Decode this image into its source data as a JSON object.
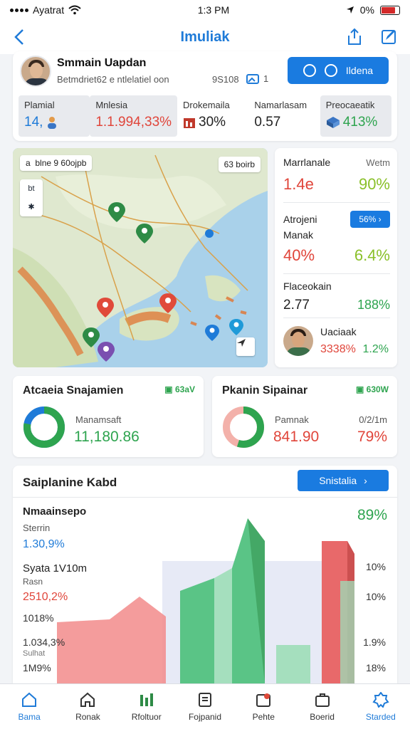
{
  "status": {
    "carrier": "Ayatrat",
    "time": "1:3 PM",
    "battery_text": "0%"
  },
  "nav": {
    "title": "Imuliak"
  },
  "profile": {
    "name": "Smmain Uapdan",
    "subtitle": "Betmdriet62 e ntlelatiel oon",
    "code": "9S108",
    "count": "1",
    "button_label": "Ildena",
    "stats": [
      {
        "label": "Plamial",
        "value": "14,",
        "color": "#1f7bd8"
      },
      {
        "label": "Mnlesia",
        "value": "1.1.994,33%",
        "color": "#e0453a"
      },
      {
        "label": "Drokemaila",
        "value": "30%",
        "color": "#222222"
      },
      {
        "label": "Namarlasam",
        "value": "0.57",
        "color": "#222222"
      },
      {
        "label": "Preocaeatik",
        "value": "413%",
        "color": "#2ea44f"
      }
    ]
  },
  "map": {
    "chip_left_a": "a",
    "chip_left_b": "blne 9 60ojpb",
    "chip_right": "63 boirb",
    "ctrl_top": "bt",
    "ctrl_bottom": "✱"
  },
  "side": {
    "s1_title": "Marrlanale",
    "s1_sub": "Wetm",
    "s1_v1": "1.4e",
    "s1_v2": "90%",
    "s2_title_a": "Atrojeni",
    "s2_chip": "56%",
    "s2_title_b": "Manak",
    "s2_v1": "40%",
    "s2_v2": "6.4%",
    "s3_title": "Flaceokain",
    "s3_v1": "2.77",
    "s3_v2": "188%",
    "s4_title": "Uaciaak",
    "s4_v1": "3338%",
    "s4_v2": "1.2%"
  },
  "kpi_left": {
    "title": "Atcaeia Snajamien",
    "badge": "63aV",
    "label": "Manamsaft",
    "value": "11,180.86",
    "donut_fraction": 0.78
  },
  "kpi_right": {
    "title": "Pkanin Sipainar",
    "badge": "630W",
    "label": "Pamnak",
    "label2": "0/2/1m",
    "value": "841.90",
    "pct": "79%",
    "donut_fraction": 0.55
  },
  "bottom": {
    "title": "Saiplanine Kabd",
    "button_label": "Snistalia",
    "r1_title": "Nmaainsepo",
    "r1_pct": "89%",
    "r1_sub": "Sterrin",
    "r1_val": "1.30,9%",
    "r2_title": "Syata 1V10m",
    "r2_right": "10%",
    "r2_sub": "Rasn",
    "r2_val": "2510,2%",
    "r2_right2": "10%",
    "r3_val": "1018%",
    "r4_val": "1.034,3%",
    "r4_right": "1.9%",
    "r4_sub": "Sulhat",
    "r5_val": "1M9%",
    "r5_right": "18%"
  },
  "tabs": [
    {
      "label": "Bama",
      "icon": "home-icon",
      "active": true
    },
    {
      "label": "Ronak",
      "icon": "house-outline-icon",
      "active": false
    },
    {
      "label": "Rfoltuor",
      "icon": "chart-icon",
      "active": false
    },
    {
      "label": "Fojpanid",
      "icon": "document-icon",
      "active": false
    },
    {
      "label": "Pehte",
      "icon": "image-icon",
      "active": false
    },
    {
      "label": "Boerid",
      "icon": "briefcase-icon",
      "active": false
    },
    {
      "label": "Starded",
      "icon": "badge-icon",
      "active": true
    }
  ],
  "colors": {
    "accent": "#1a7be0",
    "green": "#2ea44f",
    "red": "#e0453a",
    "lime": "#8ac02a"
  }
}
